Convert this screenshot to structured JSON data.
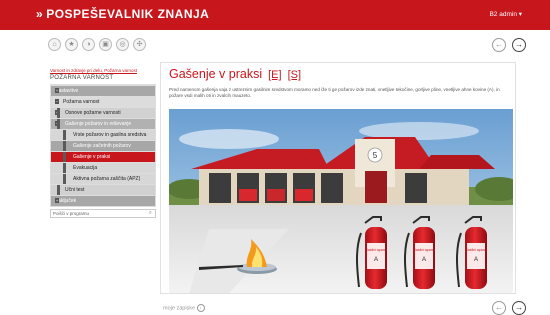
{
  "header": {
    "logo_chevrons": "»",
    "logo_text": "POSPEŠEVALNIK ZNANJA",
    "user": "B2 admin ▾"
  },
  "toolbar": {
    "icons": [
      "home-icon",
      "star-icon",
      "history-icon",
      "image-icon",
      "dots-icon",
      "settings-icon"
    ],
    "glyphs": [
      "⌂",
      "★",
      "◑",
      "▣",
      "◎",
      "✣"
    ]
  },
  "nav": {
    "prev": "←",
    "next": "→"
  },
  "sidebar": {
    "breadcrumb": "Varnost in zdravje pri delu, Požarna varnost",
    "section_title": "POŽARNA VARNOST",
    "menu": [
      {
        "label": "Nastavitve",
        "level": "l1",
        "ind": "+"
      },
      {
        "label": "Požarna varnost",
        "level": "l2",
        "ind": "−"
      },
      {
        "label": "Osnove požarne varnosti",
        "level": "l3",
        "ind": "+"
      },
      {
        "label": "Gašenje požarov in reševanje",
        "level": "l3h",
        "ind": "−"
      },
      {
        "label": "Vrste požarov in gasilna sredstva",
        "level": "l4"
      },
      {
        "label": "Gašenje začetnih požarov",
        "level": "l4g"
      },
      {
        "label": "Gašenje v praksi",
        "level": "active"
      },
      {
        "label": "Evakuacija",
        "level": "l5"
      },
      {
        "label": "Aktivna požarna zaščita (APZ)",
        "level": "l5"
      },
      {
        "label": "Učni test",
        "level": "l3"
      },
      {
        "label": "Zaključek",
        "level": "l1",
        "ind": "+"
      }
    ],
    "search_placeholder": "Poišči v programu"
  },
  "content": {
    "title": "Gašenje v praksi",
    "tag_e": "[E]",
    "tag_s": "[S]",
    "body": "Pred namenom gašenja vaja z ustreznim gasilnim sredstvom moramo ned iže ti ge požarov izde znati, vnetljive tekočine, gorljive pline, vnetljive ahne kovine (A), in požare vsdi malih oti in zvalcih mauzeto."
  },
  "photo": {
    "station_number": "5",
    "extinguisher_labels": [
      "Gasilni aparat",
      "Gasilni aparat",
      "Gasilni aparat"
    ],
    "extinguisher_classes": [
      "A",
      "A",
      "A"
    ]
  },
  "footer": {
    "download": "moje zapiske",
    "download_glyph": "↓"
  }
}
